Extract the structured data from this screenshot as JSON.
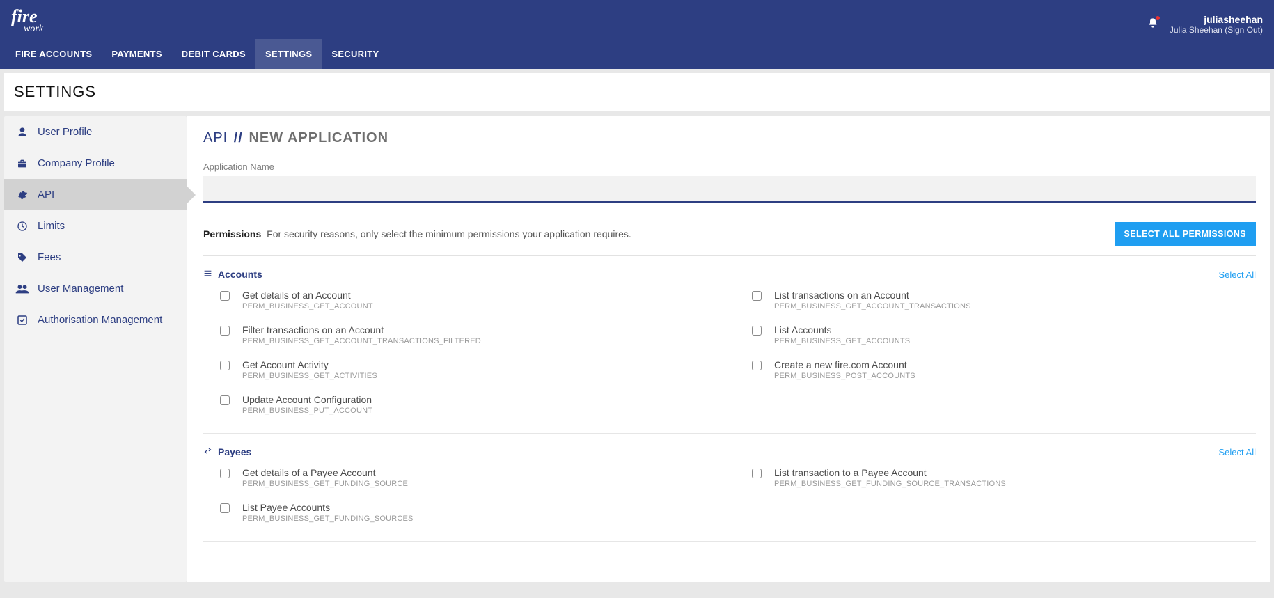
{
  "brand": {
    "line1": "fire",
    "line2": "work"
  },
  "user": {
    "username": "juliasheehan",
    "displayName": "Julia Sheehan (Sign Out)"
  },
  "mainnav": {
    "items": [
      {
        "label": "FIRE ACCOUNTS",
        "active": false
      },
      {
        "label": "PAYMENTS",
        "active": false
      },
      {
        "label": "DEBIT CARDS",
        "active": false
      },
      {
        "label": "SETTINGS",
        "active": true
      },
      {
        "label": "SECURITY",
        "active": false
      }
    ]
  },
  "pageTitle": "SETTINGS",
  "sidebar": {
    "items": [
      {
        "label": "User Profile",
        "icon": "user",
        "active": false
      },
      {
        "label": "Company Profile",
        "icon": "briefcase",
        "active": false
      },
      {
        "label": "API",
        "icon": "gear",
        "active": true
      },
      {
        "label": "Limits",
        "icon": "clock",
        "active": false
      },
      {
        "label": "Fees",
        "icon": "tag",
        "active": false
      },
      {
        "label": "User Management",
        "icon": "users",
        "active": false
      },
      {
        "label": "Authorisation Management",
        "icon": "check-square",
        "active": false
      }
    ]
  },
  "panel": {
    "title_slug": "API",
    "title_sep": " // ",
    "title_sub": "NEW APPLICATION",
    "app_name_label": "Application Name",
    "app_name_value": "",
    "app_name_placeholder": "",
    "permissions_label": "Permissions",
    "permissions_desc": "For security reasons, only select the minimum permissions your application requires.",
    "select_all_permissions_btn": "SELECT ALL PERMISSIONS"
  },
  "groups": [
    {
      "name": "Accounts",
      "icon": "list",
      "select_all": "Select All",
      "items": [
        {
          "title": "Get details of an Account",
          "code": "PERM_BUSINESS_GET_ACCOUNT"
        },
        {
          "title": "List transactions on an Account",
          "code": "PERM_BUSINESS_GET_ACCOUNT_TRANSACTIONS"
        },
        {
          "title": "Filter transactions on an Account",
          "code": "PERM_BUSINESS_GET_ACCOUNT_TRANSACTIONS_FILTERED"
        },
        {
          "title": "List Accounts",
          "code": "PERM_BUSINESS_GET_ACCOUNTS"
        },
        {
          "title": "Get Account Activity",
          "code": "PERM_BUSINESS_GET_ACTIVITIES"
        },
        {
          "title": "Create a new fire.com Account",
          "code": "PERM_BUSINESS_POST_ACCOUNTS"
        },
        {
          "title": "Update Account Configuration",
          "code": "PERM_BUSINESS_PUT_ACCOUNT"
        }
      ]
    },
    {
      "name": "Payees",
      "icon": "transfer",
      "select_all": "Select All",
      "items": [
        {
          "title": "Get details of a Payee Account",
          "code": "PERM_BUSINESS_GET_FUNDING_SOURCE"
        },
        {
          "title": "List transaction to a Payee Account",
          "code": "PERM_BUSINESS_GET_FUNDING_SOURCE_TRANSACTIONS"
        },
        {
          "title": "List Payee Accounts",
          "code": "PERM_BUSINESS_GET_FUNDING_SOURCES"
        }
      ]
    }
  ]
}
